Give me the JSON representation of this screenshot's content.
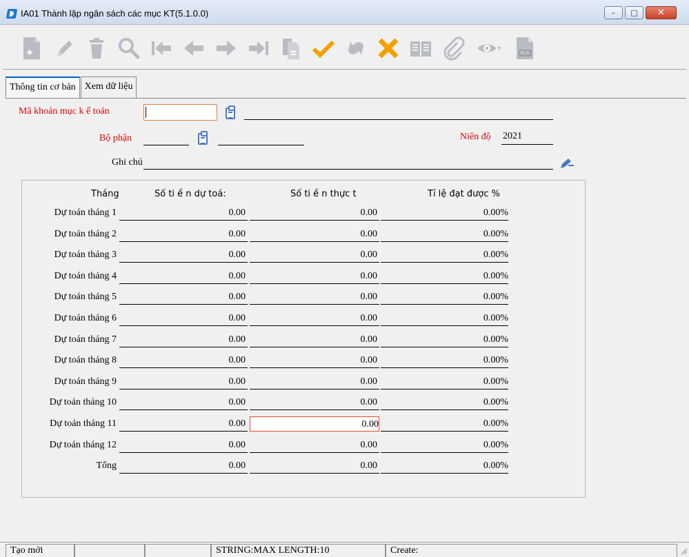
{
  "window": {
    "title": "IA01 Thành lập ngân sách các mục KT(5.1.0.0)",
    "controls": {
      "minimize": "–",
      "maximize": "□",
      "close": "✕"
    }
  },
  "toolbar": {
    "icons": [
      "new-icon",
      "edit-icon",
      "delete-icon",
      "search-icon",
      "first-icon",
      "previous-icon",
      "next-icon",
      "last-icon",
      "copy-icon",
      "confirm-icon",
      "refresh-icon",
      "cancel-icon",
      "book-icon",
      "attach-icon",
      "view-icon",
      "excel-icon"
    ],
    "dropdown_arrow": "▾",
    "excel_badge": "XLS"
  },
  "tabs": [
    {
      "label": "Thông tin cơ bản",
      "active": true
    },
    {
      "label": "Xem dữ liệu",
      "active": false
    }
  ],
  "form": {
    "account_code_label": "Mã khoản mục k ế toán",
    "account_code_value": "",
    "department_label": "Bộ phận",
    "department_value": "",
    "fiscal_year_label": "Niên độ",
    "fiscal_year_value": "2021",
    "note_label": "Ghi chú",
    "note_value": ""
  },
  "budget_table": {
    "headers": [
      "Tháng",
      "Số ti ề n dự toá:",
      "Số ti ề n thực t",
      "Tỉ lệ đạt được %"
    ],
    "rows": [
      {
        "label": "Dự toán tháng 1",
        "budget": "0.00",
        "actual": "0.00",
        "ratio": "0.00%"
      },
      {
        "label": "Dự toán tháng 2",
        "budget": "0.00",
        "actual": "0.00",
        "ratio": "0.00%"
      },
      {
        "label": "Dự toán tháng 3",
        "budget": "0.00",
        "actual": "0.00",
        "ratio": "0.00%"
      },
      {
        "label": "Dự toán tháng 4",
        "budget": "0.00",
        "actual": "0.00",
        "ratio": "0.00%"
      },
      {
        "label": "Dự toán tháng 5",
        "budget": "0.00",
        "actual": "0.00",
        "ratio": "0.00%"
      },
      {
        "label": "Dự toán tháng 6",
        "budget": "0.00",
        "actual": "0.00",
        "ratio": "0.00%"
      },
      {
        "label": "Dự toán tháng 7",
        "budget": "0.00",
        "actual": "0.00",
        "ratio": "0.00%"
      },
      {
        "label": "Dự toán tháng 8",
        "budget": "0.00",
        "actual": "0.00",
        "ratio": "0.00%"
      },
      {
        "label": "Dự toán tháng 9",
        "budget": "0.00",
        "actual": "0.00",
        "ratio": "0.00%"
      },
      {
        "label": "Dự toán tháng 10",
        "budget": "0.00",
        "actual": "0.00",
        "ratio": "0.00%"
      },
      {
        "label": "Dự toán tháng 11",
        "budget": "0.00",
        "actual": "0.00",
        "ratio": "0.00%"
      },
      {
        "label": "Dự toán tháng 12",
        "budget": "0.00",
        "actual": "0.00",
        "ratio": "0.00%"
      },
      {
        "label": "Tổng",
        "budget": "0.00",
        "actual": "0.00",
        "ratio": "0.00%"
      }
    ]
  },
  "statusbar": {
    "mode": "Tạo mới",
    "field_info": "STRING:MAX LENGTH:10",
    "create": "Create:"
  },
  "colors": {
    "required_label": "#e00000",
    "focus_border": "#e05030",
    "icon_gray": "#b9bcc2",
    "icon_orange": "#f4a000",
    "tab_accent": "#0060c0"
  }
}
